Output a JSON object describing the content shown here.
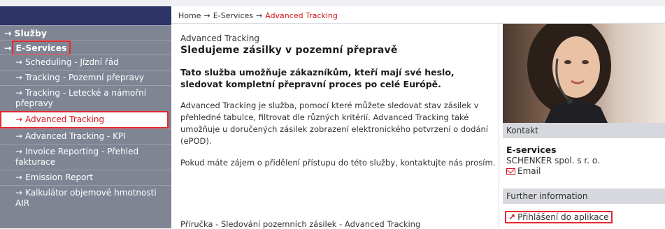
{
  "breadcrumb": {
    "home": "Home",
    "arrow": "→",
    "services": "E-Services",
    "current": "Advanced Tracking"
  },
  "sidebar": {
    "arrow": "→",
    "items": [
      {
        "label": "Služby",
        "level": "top"
      },
      {
        "label": "E-Services",
        "level": "top",
        "highlight": true
      },
      {
        "label": "Scheduling - Jízdní řád",
        "level": "sub"
      },
      {
        "label": "Tracking - Pozemní přepravy",
        "level": "sub"
      },
      {
        "label": "Tracking - Letecké a námořní přepravy",
        "level": "sub"
      },
      {
        "label": "Advanced Tracking",
        "level": "sub",
        "active": true
      },
      {
        "label": "Advanced Tracking - KPI",
        "level": "sub"
      },
      {
        "label": "Invoice Reporting - Přehled fakturace",
        "level": "sub"
      },
      {
        "label": "Emission Report",
        "level": "sub"
      },
      {
        "label": "Kalkulátor objemové hmotnosti AIR",
        "level": "sub"
      }
    ]
  },
  "main": {
    "eyebrow": "Advanced Tracking",
    "title": "Sledujeme zásilky v pozemní přepravě",
    "lead": "Tato služba umožňuje zákazníkům, kteří mají své heslo, sledovat kompletní přepravní proces po celé Európě.",
    "para1": "Advanced Tracking je služba, pomocí které můžete sledovat stav zásilek v přehledné tabulce, filtrovat dle různých kritérií. Advanced Tracking také umožňuje u doručených zásilek zobrazení elektronického potvrzení o dodání (ePOD).",
    "para2": "Pokud máte zájem o přidělení přístupu do této služby, kontaktujte nás prosím.",
    "doc_link": "Příručka - Sledování pozemních zásilek - Advanced Tracking"
  },
  "right": {
    "contact_heading": "Kontakt",
    "contact_name": "E-services",
    "contact_company": "SCHENKER spol. s r. o.",
    "contact_email": "Email",
    "further_heading": "Further information",
    "app_link_glyph": "↗",
    "app_link": "Přihlášení do aplikace"
  },
  "colors": {
    "accent": "#d4121b",
    "sidebar": "#808594",
    "sidebar_header": "#2d3466",
    "highlight_border": "#e8282f"
  }
}
